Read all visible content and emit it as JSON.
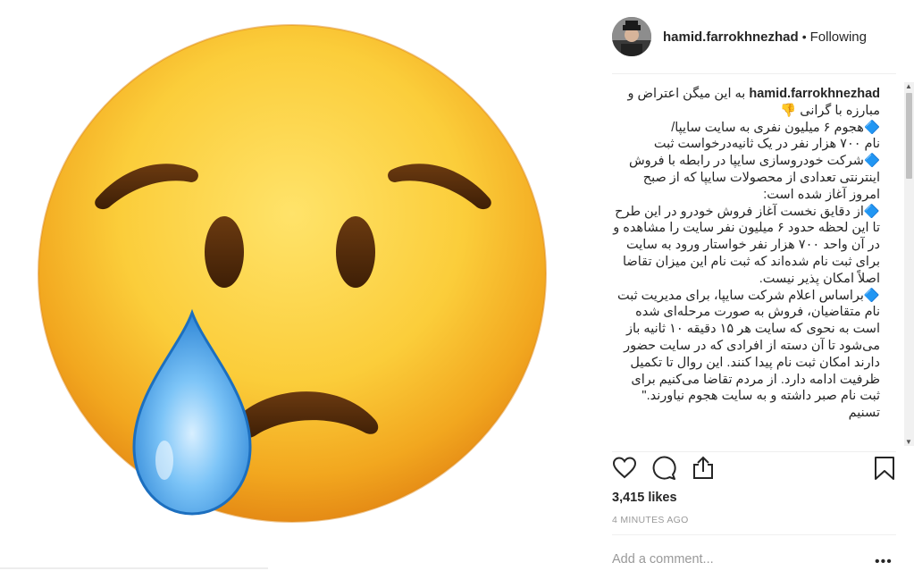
{
  "post": {
    "username": "hamid.farrokhnezhad",
    "separator": "•",
    "follow_status": "Following",
    "caption_user": "hamid.farrokhnezhad",
    "caption_text": " به این میگن اعتراض و مبارزه با گرانی 👎\n🔷هجوم ۶ میلیون نفری به سایت سایپا/\nنام ۷۰۰ هزار نفر در یک ثانیه‌درخواست ثبت\n🔷شرکت خودروسازی سایپا در رابطه با فروش اینترنتی تعدادی از محصولات سایپا که از صبح امروز آغاز شده است:\n🔷از دقایق نخست آغاز فروش خودرو در این طرح تا این لحظه حدود ۶ میلیون نفر سایت را مشاهده و در آن واحد ۷۰۰ هزار نفر خواستار ورود به سایت برای ثبت نام شده‌اند که ثبت نام این میزان تقاضا اصلاً امکان پذیر نیست.\n🔷براساس اعلام شرکت سایپا، برای مدیریت ثبت نام متقاضیان، فروش به صورت مرحله‌ای شده است به نحوی که سایت هر ۱۵ دقیقه ۱۰ ثانیه باز می‌شود تا آن دسته از افرادی که در سایت حضور دارند امکان ثبت نام پیدا کنند. این روال تا تکمیل ظرفیت ادامه دارد. از مردم تقاضا می‌کنیم برای ثبت نام صبر داشته و به سایت هجوم نیاورند.\"\nتسنیم",
    "likes": "3,415 likes",
    "timestamp": "4 MINUTES AGO",
    "comment_placeholder": "Add a comment...",
    "more_label": "•••"
  },
  "icons": {
    "like": "heart-icon",
    "comment": "comment-bubble-icon",
    "share": "share-icon",
    "save": "bookmark-icon",
    "media": "crying-face-emoji"
  },
  "colors": {
    "diamond": "#2f7fe6",
    "emoji_face": "#f7c02b",
    "tear": "#4aa8ef",
    "timestamp": "#999999"
  }
}
